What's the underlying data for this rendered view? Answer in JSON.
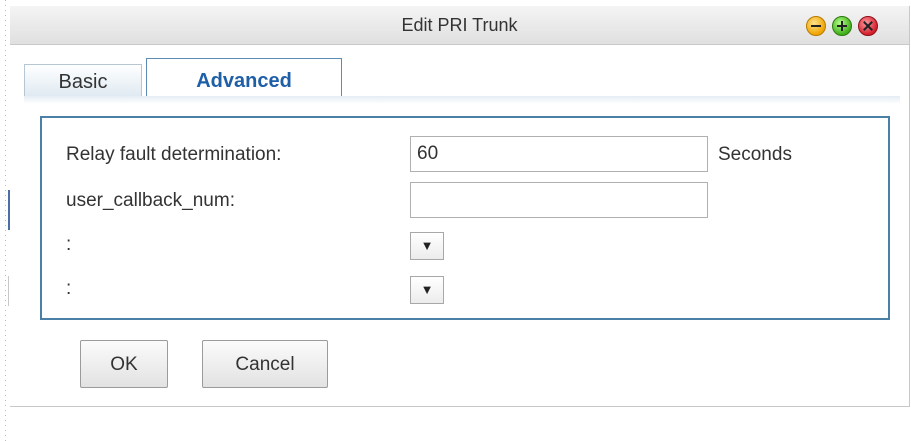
{
  "window": {
    "title": "Edit PRI Trunk",
    "controls": [
      "minimize-icon",
      "maximize-icon",
      "close-icon"
    ]
  },
  "tabs": [
    {
      "label": "Basic",
      "active": false
    },
    {
      "label": "Advanced",
      "active": true
    }
  ],
  "form": {
    "relay_fault": {
      "label": "Relay fault determination:",
      "value": "60",
      "unit": "Seconds"
    },
    "user_callback": {
      "label": "user_callback_num:",
      "value": ""
    },
    "select1": {
      "label": ":",
      "value": "",
      "arrow": "▼"
    },
    "select2": {
      "label": ":",
      "value": "",
      "arrow": "▼"
    }
  },
  "buttons": {
    "ok": "OK",
    "cancel": "Cancel"
  },
  "colors": {
    "accent": "#1f5fa8",
    "panel_border": "#4a7fa6"
  }
}
